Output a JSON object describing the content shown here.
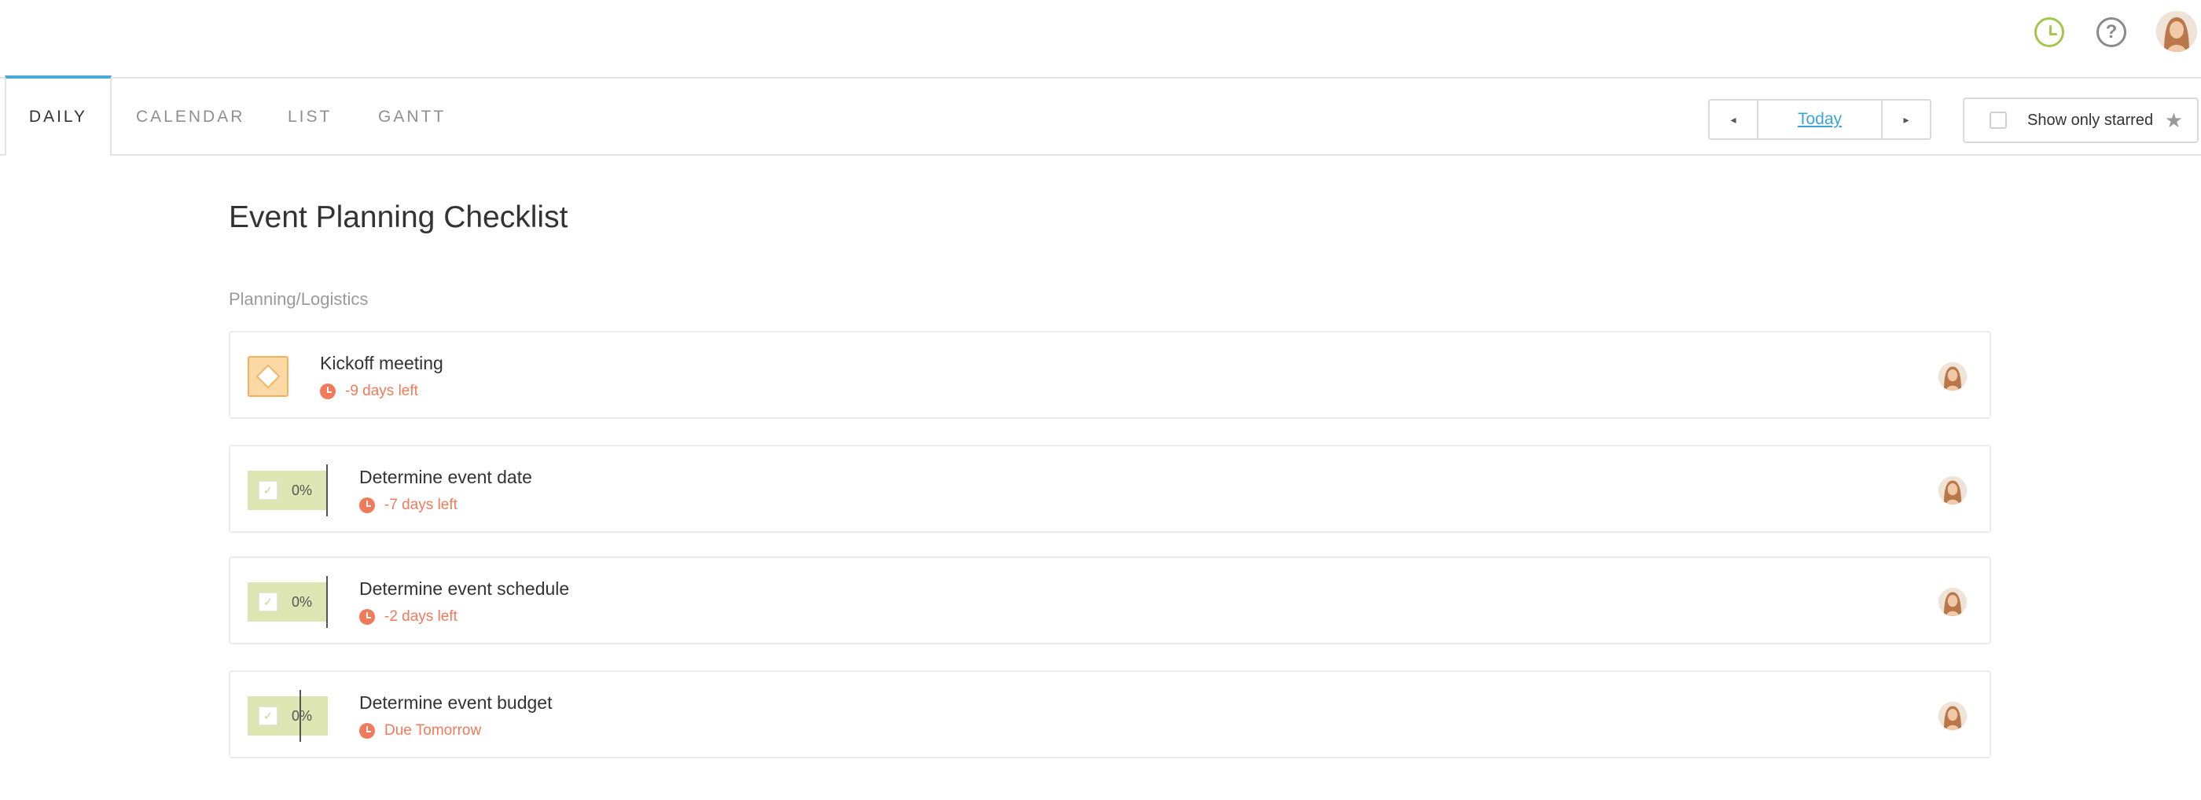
{
  "header": {
    "icons": [
      "clock-icon",
      "help-icon",
      "user-avatar"
    ],
    "help_glyph": "?",
    "accent_color": "#4aa9d6"
  },
  "tabs": [
    {
      "label": "DAILY",
      "active": true
    },
    {
      "label": "CALENDAR",
      "active": false
    },
    {
      "label": "LIST",
      "active": false
    },
    {
      "label": "GANTT",
      "active": false
    }
  ],
  "date_nav": {
    "prev_glyph": "◂",
    "today_label": "Today",
    "next_glyph": "▸"
  },
  "filter": {
    "starred_label": "Show only starred",
    "starred_checked": false,
    "star_glyph": "★"
  },
  "page": {
    "title": "Event Planning Checklist",
    "section": "Planning/Logistics"
  },
  "tasks": [
    {
      "name": "Kickoff meeting",
      "due": "-9 days left",
      "type": "milestone",
      "progress": null
    },
    {
      "name": "Determine event date",
      "due": "-7 days left",
      "type": "task",
      "progress": "0%"
    },
    {
      "name": "Determine event schedule",
      "due": "-2 days left",
      "type": "task",
      "progress": "0%"
    },
    {
      "name": "Determine event budget",
      "due": "Due Tomorrow",
      "type": "task",
      "progress": "0%"
    }
  ],
  "colors": {
    "overdue": "#f07a5a",
    "milestone": "#fbd9a6",
    "progress": "#dde6b2",
    "clock_icon": "#a3c64a"
  }
}
